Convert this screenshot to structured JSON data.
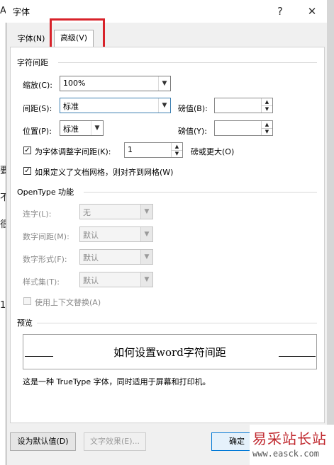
{
  "titlebar": {
    "title": "字体",
    "help": "?",
    "close": "✕"
  },
  "tabs": {
    "font": "字体(N)",
    "advanced": "高级(V)"
  },
  "char_spacing": {
    "section": "字符间距",
    "scale_label": "缩放(C):",
    "scale_value": "100%",
    "spacing_label": "间距(S):",
    "spacing_value": "标准",
    "spacing_pt_label": "磅值(B):",
    "spacing_pt_value": "",
    "position_label": "位置(P):",
    "position_value": "标准",
    "position_pt_label": "磅值(Y):",
    "position_pt_value": "",
    "kerning_label": "为字体调整字间距(K):",
    "kerning_value": "1",
    "kerning_suffix": "磅或更大(O)",
    "kerning_checked": true,
    "grid_label": "如果定义了文档网格，则对齐到网格(W)",
    "grid_checked": true
  },
  "opentype": {
    "section": "OpenType 功能",
    "ligatures_label": "连字(L):",
    "ligatures_value": "无",
    "num_spacing_label": "数字间距(M):",
    "num_spacing_value": "默认",
    "num_forms_label": "数字形式(F):",
    "num_forms_value": "默认",
    "stylistic_label": "样式集(T):",
    "stylistic_value": "默认",
    "contextual_label": "使用上下文替换(A)"
  },
  "preview": {
    "section": "预览",
    "sample": "如何设置word字符间距",
    "note": "这是一种 TrueType 字体，同时适用于屏幕和打印机。"
  },
  "buttons": {
    "default": "设为默认值(D)",
    "text_effects": "文字效果(E)...",
    "ok": "确定"
  },
  "left_edge": [
    "A",
    "要",
    "不",
    "很",
    "1"
  ],
  "watermark": {
    "text": "易采站长站",
    "url": "www.easck.com"
  },
  "colors": {
    "highlight": "#d8222a",
    "accent": "#0078d7"
  }
}
